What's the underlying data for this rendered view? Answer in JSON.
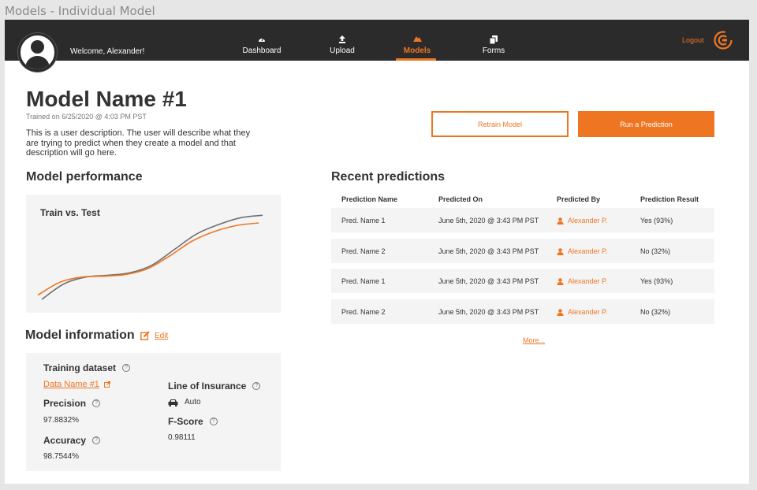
{
  "window_title": "Models - Individual Model",
  "navbar": {
    "welcome": "Welcome, Alexander!",
    "items": [
      {
        "label": "Dashboard",
        "icon": "gauge-icon"
      },
      {
        "label": "Upload",
        "icon": "upload-icon"
      },
      {
        "label": "Models",
        "icon": "models-icon",
        "active": true
      },
      {
        "label": "Forms",
        "icon": "forms-icon"
      }
    ],
    "logout": "Logout",
    "accent_color": "#ee7623",
    "bg_color": "#2b2b2b"
  },
  "model": {
    "name": "Model Name #1",
    "trained": "Trained on 6/25/2020 @ 4:03 PM PST",
    "description": "This is a user description. The user will describe what they are trying to predict when they create a model and that description will go here."
  },
  "actions": {
    "retrain": "Retrain Model",
    "run_prediction": "Run a Prediction"
  },
  "performance": {
    "heading": "Model performance",
    "chart_title": "Train vs. Test"
  },
  "chart_data": {
    "type": "line",
    "title": "Train vs. Test",
    "xlabel": "",
    "ylabel": "",
    "x": [
      0,
      1,
      2,
      3,
      4,
      5,
      6,
      7,
      8,
      9,
      10
    ],
    "series": [
      {
        "color": "#707070",
        "values": [
          0.0,
          0.18,
          0.26,
          0.28,
          0.31,
          0.4,
          0.58,
          0.76,
          0.87,
          0.95,
          0.98
        ]
      },
      {
        "color": "#ee7623",
        "values": [
          0.05,
          0.2,
          0.26,
          0.27,
          0.29,
          0.36,
          0.51,
          0.68,
          0.79,
          0.86,
          0.89
        ]
      }
    ],
    "ylim": [
      0,
      1
    ],
    "grid": false
  },
  "info": {
    "heading": "Model information",
    "edit": "Edit",
    "training_dataset_label": "Training dataset",
    "training_dataset_value": "Data Name #1",
    "precision_label": "Precision",
    "precision_value": "97.8832%",
    "accuracy_label": "Accuracy",
    "accuracy_value": "98.7544%",
    "line_label": "Line of Insurance",
    "line_value": "Auto",
    "fscore_label": "F-Score",
    "fscore_value": "0.98111"
  },
  "predictions": {
    "heading": "Recent predictions",
    "columns": [
      "Prediction Name",
      "Predicted On",
      "Predicted By",
      "Prediction Result"
    ],
    "rows": [
      [
        "Pred. Name 1",
        "June 5th, 2020 @ 3:43 PM PST",
        "Alexander P.",
        "Yes (93%)"
      ],
      [
        "Pred. Name 2",
        "June 5th, 2020 @ 3:43 PM PST",
        "Alexander P.",
        "No (32%)"
      ],
      [
        "Pred. Name 1",
        "June 5th, 2020 @ 3:43 PM PST",
        "Alexander P.",
        "Yes (93%)"
      ],
      [
        "Pred. Name 2",
        "June 5th, 2020 @ 3:43 PM PST",
        "Alexander P.",
        "No (32%)"
      ]
    ],
    "more": "More..."
  }
}
